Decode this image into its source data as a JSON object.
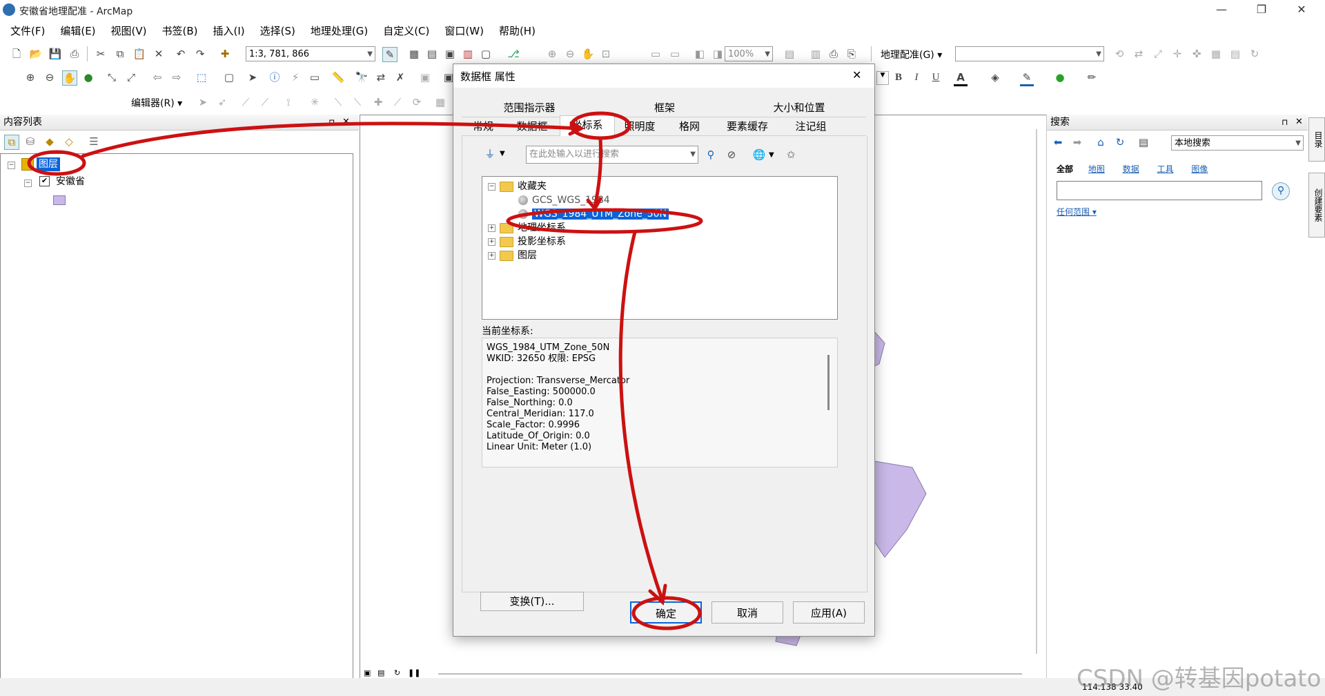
{
  "window": {
    "title": "安徽省地理配准 - ArcMap",
    "minimize": "—",
    "restore": "❐",
    "close": "✕"
  },
  "menu": [
    "文件(F)",
    "编辑(E)",
    "视图(V)",
    "书签(B)",
    "插入(I)",
    "选择(S)",
    "地理处理(G)",
    "自定义(C)",
    "窗口(W)",
    "帮助(H)"
  ],
  "toolbar": {
    "scale": "1:3, 781, 866",
    "zoom": "100%",
    "georef_label": "地理配准(G)",
    "editor_label": "编辑器(R)",
    "bold": "B",
    "italic": "I",
    "underline": "U",
    "font_color": "A"
  },
  "toc": {
    "title": "内容列表",
    "pin": "⊓",
    "close": "✕",
    "layers_label": "图层",
    "layer_name": "安徽省"
  },
  "search_panel": {
    "title": "搜索",
    "scope": "本地搜索",
    "filters": [
      "全部",
      "地图",
      "数据",
      "工具",
      "图像"
    ],
    "any_extent": "任何范围",
    "side_tabs": [
      "目录",
      "创建要素"
    ]
  },
  "dialog": {
    "title": "数据框 属性",
    "close": "✕",
    "tabs_row1": [
      "范围指示器",
      "框架",
      "大小和位置"
    ],
    "tabs_row2": [
      "常规",
      "数据框",
      "坐标系",
      "照明度",
      "格网",
      "要素缓存",
      "注记组"
    ],
    "active_tab": "坐标系",
    "search_placeholder": "在此处输入以进行搜索",
    "tree": [
      {
        "label": "收藏夹",
        "expand": "⊟",
        "type": "folder"
      },
      {
        "label": "GCS_WGS_1984",
        "type": "globe"
      },
      {
        "label": "WGS_1984_UTM_Zone_50N",
        "type": "globe",
        "selected": true
      },
      {
        "label": "地理坐标系",
        "expand": "⊞",
        "type": "folder"
      },
      {
        "label": "投影坐标系",
        "expand": "⊞",
        "type": "folder"
      },
      {
        "label": "图层",
        "expand": "⊞",
        "type": "folder"
      }
    ],
    "current_cs_label": "当前坐标系:",
    "current_cs_lines": [
      "WGS_1984_UTM_Zone_50N",
      "WKID: 32650 权限: EPSG",
      "",
      "Projection: Transverse_Mercator",
      "False_Easting: 500000.0",
      "False_Northing: 0.0",
      "Central_Meridian: 117.0",
      "Scale_Factor: 0.9996",
      "Latitude_Of_Origin: 0.0",
      "Linear Unit: Meter (1.0)"
    ],
    "transform_button": "变换(T)...",
    "ok_button": "确定",
    "cancel_button": "取消",
    "apply_button": "应用(A)"
  },
  "status": {
    "coords": "114.138  33.40",
    "watermark": "CSDN @转基因potato"
  },
  "colors": {
    "annotation_red": "#cc1111",
    "selection_blue": "#0a64d8",
    "polygon_fill": "#c9b8e8"
  }
}
